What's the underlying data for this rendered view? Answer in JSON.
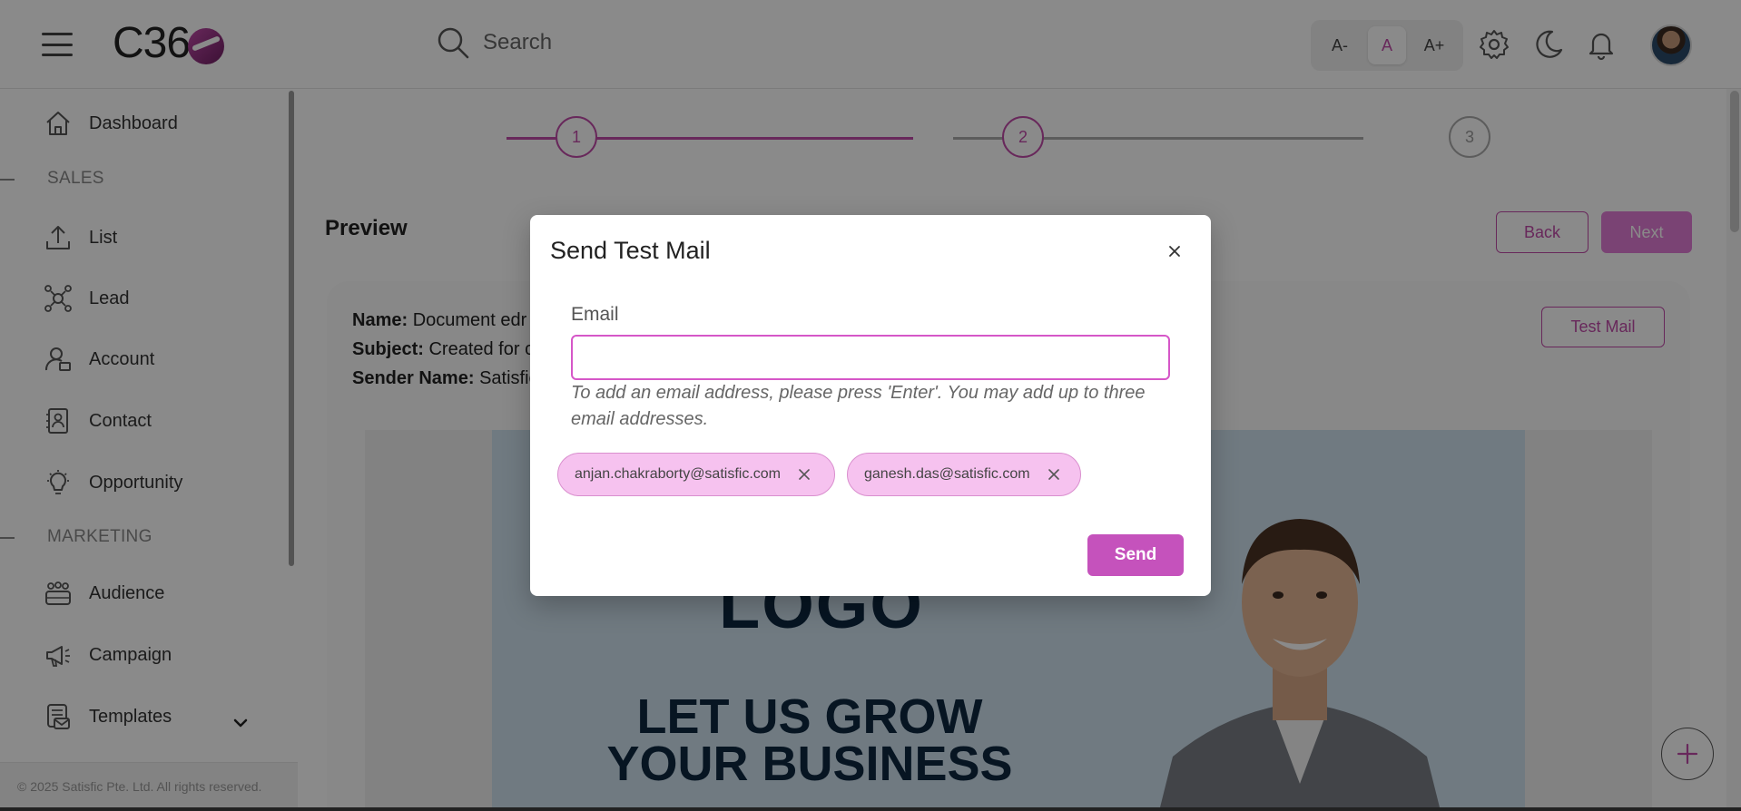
{
  "header": {
    "logo_text": "C36",
    "search_placeholder": "Search",
    "font_decrease": "A-",
    "font_normal": "A",
    "font_increase": "A+"
  },
  "sidebar": {
    "items": [
      {
        "label": "Dashboard",
        "icon": "home-icon"
      },
      {
        "label": "List",
        "icon": "upload-icon"
      },
      {
        "label": "Lead",
        "icon": "network-icon"
      },
      {
        "label": "Account",
        "icon": "user-account-icon"
      },
      {
        "label": "Contact",
        "icon": "contact-card-icon"
      },
      {
        "label": "Opportunity",
        "icon": "lightbulb-icon"
      },
      {
        "label": "Audience",
        "icon": "group-icon"
      },
      {
        "label": "Campaign",
        "icon": "megaphone-icon"
      },
      {
        "label": "Templates",
        "icon": "template-icon"
      }
    ],
    "sections": [
      "SALES",
      "MARKETING"
    ],
    "footer": "© 2025 Satisfic Pte. Ltd. All rights reserved."
  },
  "stepper": {
    "steps": [
      "1",
      "2",
      "3"
    ],
    "current_step": 2
  },
  "main": {
    "title": "Preview",
    "back_label": "Back",
    "next_label": "Next",
    "test_mail_label": "Test Mail",
    "name_label": "Name:",
    "name_value": "Document edr",
    "subject_label": "Subject:",
    "subject_value": "Created for c",
    "sender_label": "Sender Name:",
    "sender_value": "Satisfic",
    "banner_headline": "LET US GROW YOUR BUSINESS",
    "banner_logo_fragment": "LOGO"
  },
  "modal": {
    "title": "Send Test Mail",
    "email_label": "Email",
    "email_value": "",
    "help_text": "To add an email address, please press 'Enter'. You may add up to three email addresses.",
    "chips": [
      "anjan.chakraborty@satisfic.com",
      "ganesh.das@satisfic.com"
    ],
    "send_label": "Send"
  },
  "colors": {
    "accent": "#c04aa8",
    "chip_bg": "#f6c2ef",
    "send_bg": "#c552bc",
    "headline": "#0d2740"
  }
}
